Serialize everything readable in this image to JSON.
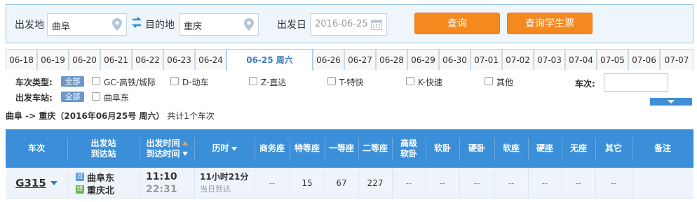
{
  "search": {
    "from_label": "出发地",
    "from_value": "曲阜",
    "to_label": "目的地",
    "to_value": "重庆",
    "date_label": "出发日",
    "date_value": "2016-06-25",
    "query_button": "查询",
    "student_button": "查询学生票"
  },
  "date_tabs": [
    "06-18",
    "06-19",
    "06-20",
    "06-21",
    "06-22",
    "06-23",
    "06-24",
    "06-25 周六",
    "06-26",
    "06-27",
    "06-28",
    "06-29",
    "06-30",
    "07-01",
    "07-02",
    "07-03",
    "07-04",
    "07-05",
    "07-06",
    "07-07"
  ],
  "active_date_index": 7,
  "filters": {
    "train_type_label": "车次类型:",
    "depart_station_label": "出发车站:",
    "all_label": "全部",
    "train_types": [
      "GC-高铁/城际",
      "D-动车",
      "Z-直达",
      "T-特快",
      "K-快速",
      "其他"
    ],
    "stations": [
      "曲阜东"
    ],
    "train_no_label": "车次:"
  },
  "summary": {
    "route": "曲阜 -> 重庆（2016年06月25号 周六）",
    "count": "共计1个车次"
  },
  "table": {
    "headers": {
      "train": "车次",
      "from_station": "出发站",
      "to_station": "到达站",
      "depart_time": "出发时间",
      "arrive_time": "到达时间",
      "duration": "历时",
      "business": "商务座",
      "premium": "特等座",
      "first": "一等座",
      "second": "二等座",
      "soft_sleeper_adv_1": "高级",
      "soft_sleeper_adv_2": "软卧",
      "soft_sleeper": "软卧",
      "hard_sleeper": "硬卧",
      "soft_seat": "软座",
      "hard_seat": "硬座",
      "no_seat": "无座",
      "other": "其它",
      "remark": "备注"
    },
    "rows": [
      {
        "train": "G315",
        "from_station": "曲阜东",
        "to_station": "重庆北",
        "from_icon": "过",
        "to_icon": "终",
        "depart_time": "11:10",
        "arrive_time": "22:31",
        "duration": "11小时21分",
        "arrival_day": "当日到达",
        "business": "--",
        "premium": "15",
        "first": "67",
        "second": "227",
        "adv_soft_sleeper": "--",
        "soft_sleeper": "--",
        "hard_sleeper": "--",
        "soft_seat": "--",
        "hard_seat": "--",
        "no_seat": "--",
        "other": "--",
        "remark": ""
      }
    ]
  },
  "colors": {
    "header_blue": "#3b8fd9",
    "button_orange": "#f5891f",
    "active_tab_text": "#3a7bbf",
    "pass_icon": "#5b9bd5",
    "terminal_icon": "#6ab04c"
  }
}
